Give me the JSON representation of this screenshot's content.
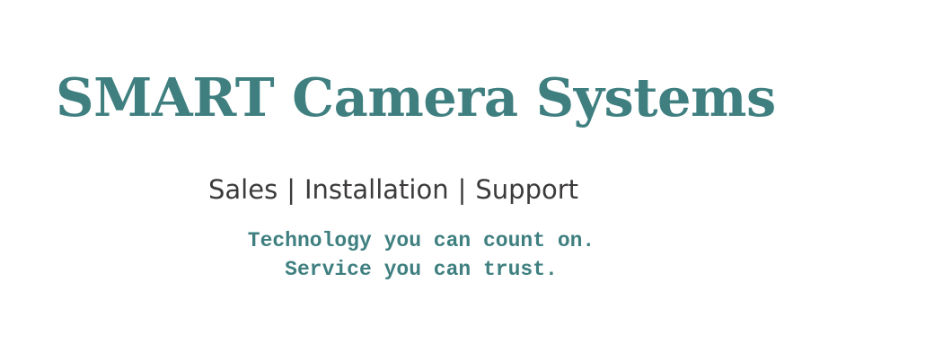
{
  "header": {
    "title": "SMART Camera Systems"
  },
  "services": {
    "items": [
      "Sales",
      "Installation",
      "Support"
    ],
    "separator": "|"
  },
  "tagline": {
    "line1": "Technology you can count on.",
    "line2": "Service you can trust."
  },
  "colors": {
    "brand": "#3f7f80",
    "text_dark": "#3c3a3a",
    "background": "#ffffff"
  }
}
